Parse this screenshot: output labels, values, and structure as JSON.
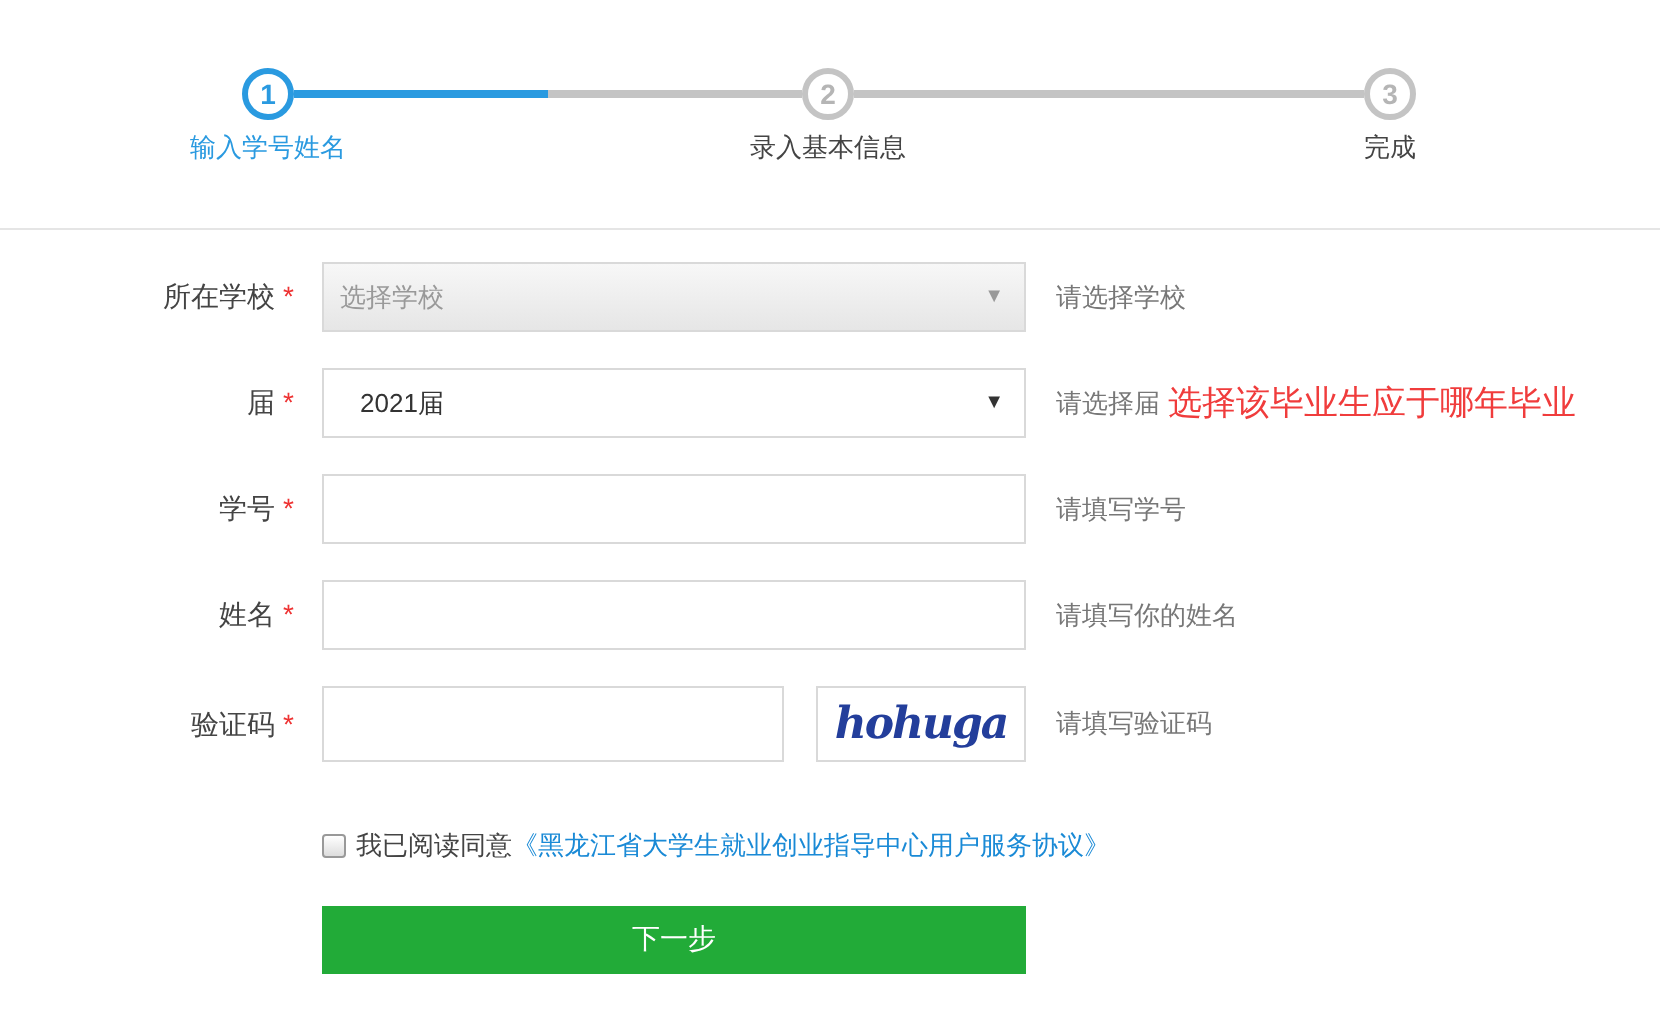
{
  "steps": [
    {
      "number": "1",
      "label": "输入学号姓名",
      "selected": true
    },
    {
      "number": "2",
      "label": "录入基本信息",
      "selected": false
    },
    {
      "number": "3",
      "label": "完成",
      "selected": false
    }
  ],
  "progress": {
    "level": 0.5
  },
  "fields": [
    {
      "kind": "select",
      "label": "所在学校",
      "required": "*",
      "placeholder": "选择学校",
      "arrow": "▼",
      "disabled": true,
      "hint": "请选择学校"
    },
    {
      "kind": "select",
      "label": "届",
      "required": "*",
      "value": "2021届",
      "arrow": "▼",
      "disabled": false,
      "hint": "请选择届",
      "note": "选择该毕业生应于哪年毕业"
    },
    {
      "kind": "input",
      "label": "学号",
      "required": "*",
      "hint": "请填写学号"
    },
    {
      "kind": "input",
      "label": "姓名",
      "required": "*",
      "hint": "请填写你的姓名"
    },
    {
      "kind": "captcha",
      "label": "验证码",
      "required": "*",
      "captcha": "hohuga",
      "hint": "请填写验证码"
    }
  ],
  "agreement": {
    "checked": false,
    "text": "我已阅读同意",
    "link": "《黑龙江省大学生就业创业指导中心用户服务协议》"
  },
  "submit": "下一步"
}
